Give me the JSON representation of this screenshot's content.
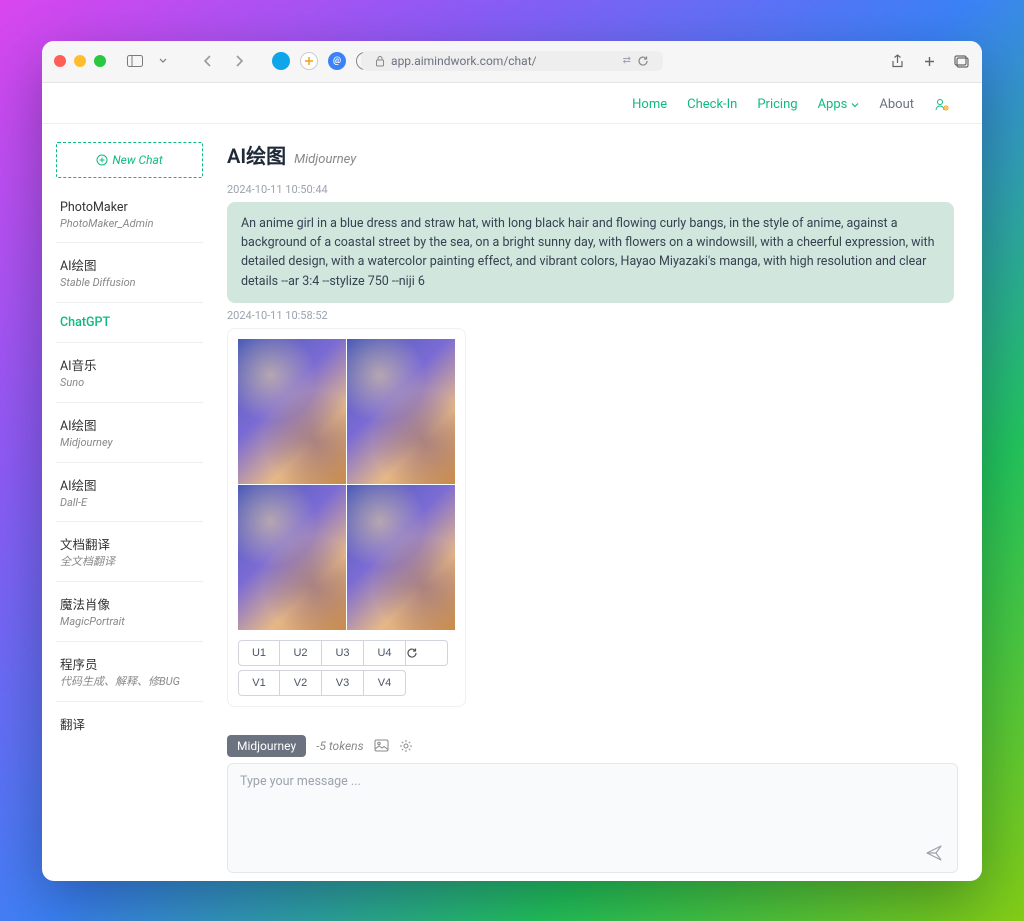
{
  "browser": {
    "url_host": "app.aimindwork.com",
    "url_path": "/chat/"
  },
  "topnav": {
    "home": "Home",
    "checkin": "Check-In",
    "pricing": "Pricing",
    "apps": "Apps",
    "about": "About"
  },
  "sidebar": {
    "new_chat": "New Chat",
    "items": [
      {
        "title": "PhotoMaker",
        "sub": "PhotoMaker_Admin"
      },
      {
        "title": "AI绘图",
        "sub": "Stable Diffusion"
      },
      {
        "title": "ChatGPT",
        "sub": ""
      },
      {
        "title": "AI音乐",
        "sub": "Suno"
      },
      {
        "title": "AI绘图",
        "sub": "Midjourney"
      },
      {
        "title": "AI绘图",
        "sub": "Dall-E"
      },
      {
        "title": "文档翻译",
        "sub": "全文档翻译"
      },
      {
        "title": "魔法肖像",
        "sub": "MagicPortrait"
      },
      {
        "title": "程序员",
        "sub": "代码生成、解释、修BUG"
      },
      {
        "title": "翻译",
        "sub": ""
      }
    ]
  },
  "chat": {
    "title": "AI绘图",
    "subtitle": "Midjourney",
    "ts1": "2024-10-11 10:50:44",
    "prompt": "An anime girl in a blue dress and straw hat, with long black hair and flowing curly bangs, in the style of anime, against a background of a coastal street by the sea, on a bright sunny day, with flowers on a windowsill, with a cheerful expression, with detailed design, with a watercolor painting effect, and vibrant colors, Hayao Miyazaki's manga, with high resolution and clear details --ar 3:4 --stylize 750 --niji 6",
    "ts2": "2024-10-11 10:58:52",
    "u_buttons": [
      "U1",
      "U2",
      "U3",
      "U4"
    ],
    "v_buttons": [
      "V1",
      "V2",
      "V3",
      "V4"
    ]
  },
  "composer": {
    "model": "Midjourney",
    "tokens": "-5 tokens",
    "placeholder": "Type your message ..."
  }
}
